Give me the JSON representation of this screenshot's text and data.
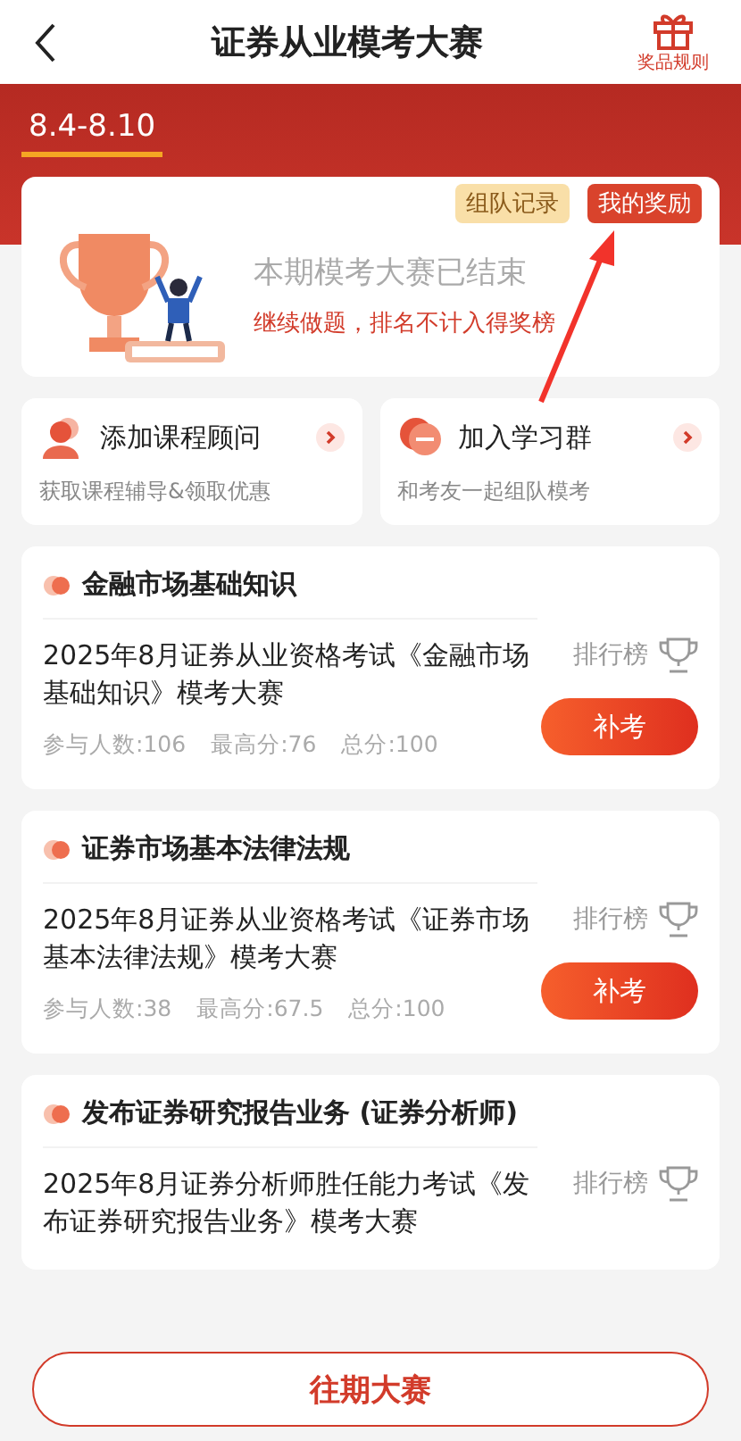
{
  "header": {
    "title": "证券从业模考大赛",
    "rules_label": "奖品规则"
  },
  "periods": [
    {
      "label": "8.4-8.10",
      "selected": true
    }
  ],
  "status_card": {
    "tags": [
      {
        "label": "组队记录",
        "kind": "plain"
      },
      {
        "label": "我的奖励",
        "kind": "highlight"
      }
    ],
    "title": "本期模考大赛已结束",
    "note": "继续做题，排名不计入得奖榜"
  },
  "shortcuts": [
    {
      "title": "添加课程顾问",
      "subtitle": "获取课程辅导&领取优惠",
      "kind": "person"
    },
    {
      "title": "加入学习群",
      "subtitle": "和考友一起组队模考",
      "kind": "chat"
    }
  ],
  "contests": [
    {
      "subject": "金融市场基础知识",
      "description": "2025年8月证券从业资格考试《金融市场基础知识》模考大赛",
      "stats": [
        "参与人数:106",
        "最高分:76",
        "总分:100"
      ],
      "rank_label": "排行榜",
      "action": "补考"
    },
    {
      "subject": "证券市场基本法律法规",
      "description": "2025年8月证券从业资格考试《证券市场基本法律法规》模考大赛",
      "stats": [
        "参与人数:38",
        "最高分:67.5",
        "总分:100"
      ],
      "rank_label": "排行榜",
      "action": "补考"
    },
    {
      "subject": "发布证券研究报告业务 (证券分析师)",
      "description": "2025年8月证券分析师胜任能力考试《发布证券研究报告业务》模考大赛",
      "rank_label": "排行榜"
    }
  ],
  "footer_button": "往期大赛"
}
